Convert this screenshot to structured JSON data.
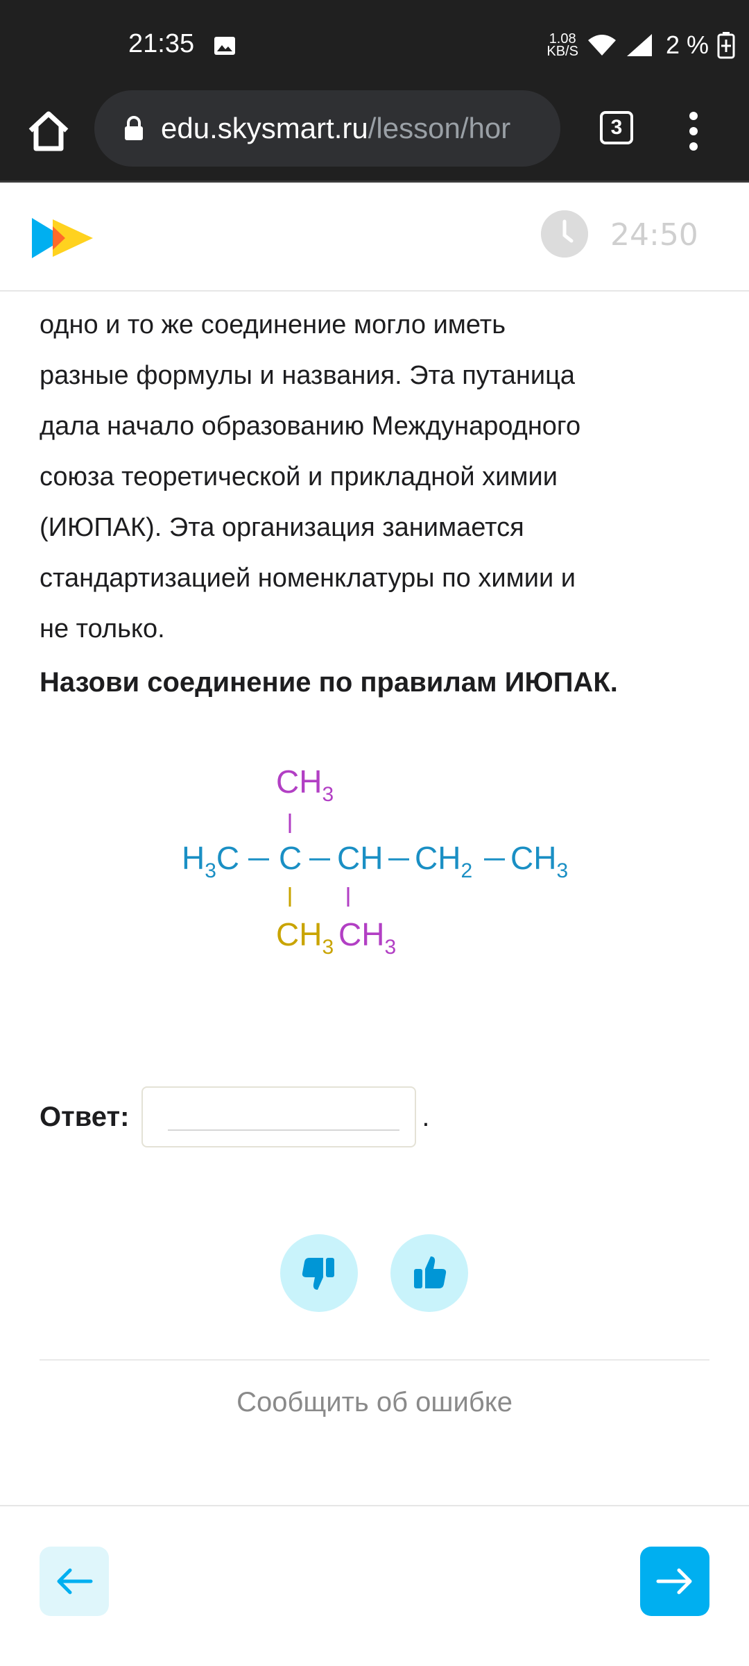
{
  "status_bar": {
    "time": "21:35",
    "speed_value": "1.08",
    "speed_unit": "KB/S",
    "battery": "2 %"
  },
  "browser": {
    "url_host": "edu.skysmart.ru",
    "url_path": "/lesson/hor",
    "tab_count": "3"
  },
  "header": {
    "timer": "24:50"
  },
  "content": {
    "paragraph_lines": [
      "одно и то же соединение могло иметь",
      "разные формулы и названия. Эта путаница",
      "дала начало образованию Международного",
      "союза теоретической и прикладной химии",
      "(ИЮПАК). Эта организация занимается",
      "стандартизацией номенклатуры по химии и",
      "не только."
    ],
    "question": "Назови соединение по правилам ИЮПАК.",
    "answer_label": "Ответ:",
    "answer_value": "",
    "answer_suffix": "."
  },
  "formula": {
    "top_group": "CH",
    "top_sub": "3",
    "chain": [
      {
        "t": "H",
        "s": "3",
        "after": "C"
      },
      {
        "t": "C"
      },
      {
        "t": "CH"
      },
      {
        "t": "CH",
        "s": "2"
      },
      {
        "t": "CH",
        "s": "3"
      }
    ],
    "bottom_left": "CH",
    "bottom_left_sub": "3",
    "bottom_right": "CH",
    "bottom_right_sub": "3",
    "colors": {
      "main": "#1a8fc4",
      "magenta": "#b23fc4",
      "yellow": "#c9a400"
    }
  },
  "feedback": {
    "report": "Сообщить об ошибке"
  },
  "colors": {
    "accent": "#00aff0",
    "accent_light": "#c9f3fb"
  }
}
